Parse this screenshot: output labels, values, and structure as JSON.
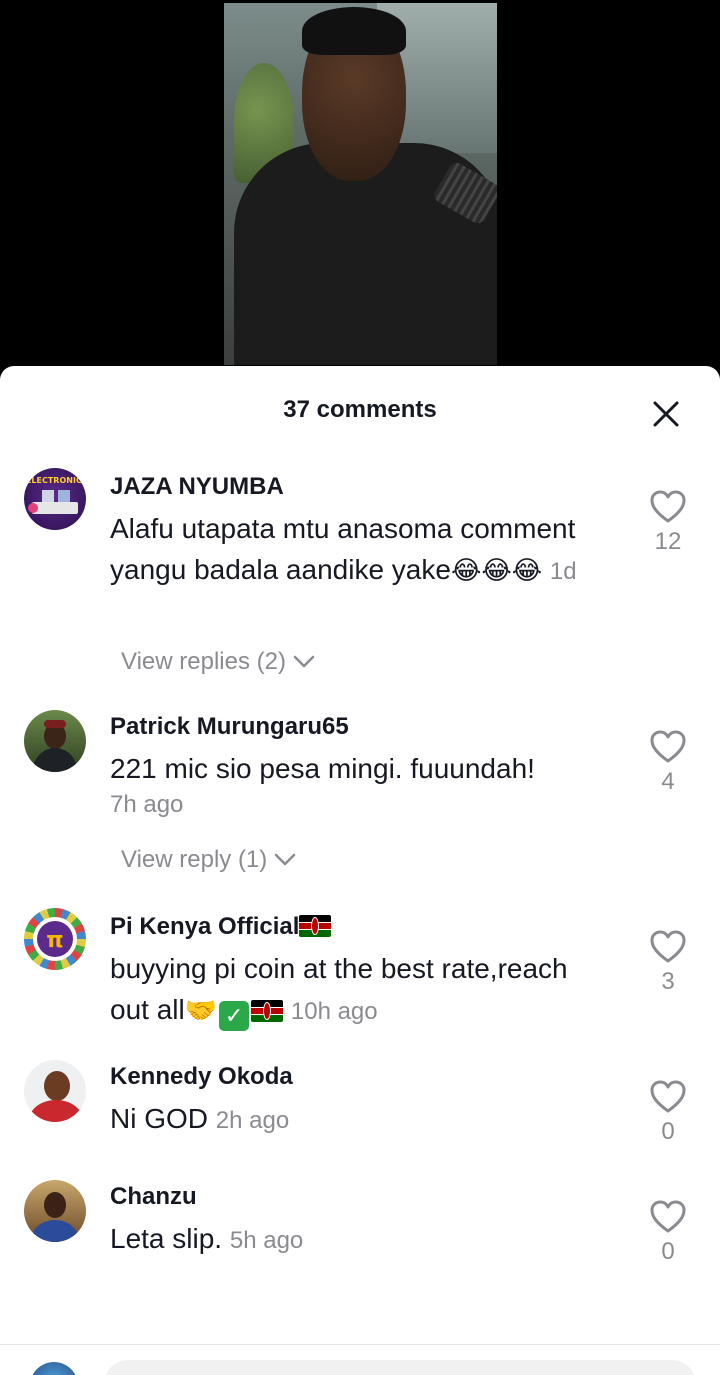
{
  "sheet": {
    "title": "37 comments"
  },
  "comments": [
    {
      "user": "JAZA NYUMBA",
      "text": "Alafu utapata mtu anasoma comment yangu badala aandike yake",
      "emoji": "😂😂😂",
      "time": "1d",
      "likes": "12",
      "replies_label": "View replies (2)",
      "avatar_text": "MEGA ELECTRONICS SALE"
    },
    {
      "user": "Patrick Murungaru65",
      "text": "221 mic sio pesa mingi. fuuundah!",
      "time": "7h ago",
      "likes": "4",
      "replies_label": "View reply (1)"
    },
    {
      "user": "Pi Kenya Official",
      "text": "buyying pi coin at the best rate,reach out all",
      "emoji": "🤝",
      "check": "✓",
      "time": "10h ago",
      "likes": "3",
      "avatar_text": "π"
    },
    {
      "user": "Kennedy Okoda",
      "text": "Ni GOD",
      "time": "2h ago",
      "likes": "0"
    },
    {
      "user": "Chanzu",
      "text": "Leta slip.",
      "time": "5h ago",
      "likes": "0"
    }
  ],
  "icons": {
    "close": "close-icon",
    "like": "heart-outline-icon",
    "chevron": "chevron-down-icon",
    "flag": "kenya-flag-icon"
  },
  "colors": {
    "text": "#161823",
    "muted": "#8a8b91",
    "sheet": "#ffffff",
    "background": "#000000"
  }
}
